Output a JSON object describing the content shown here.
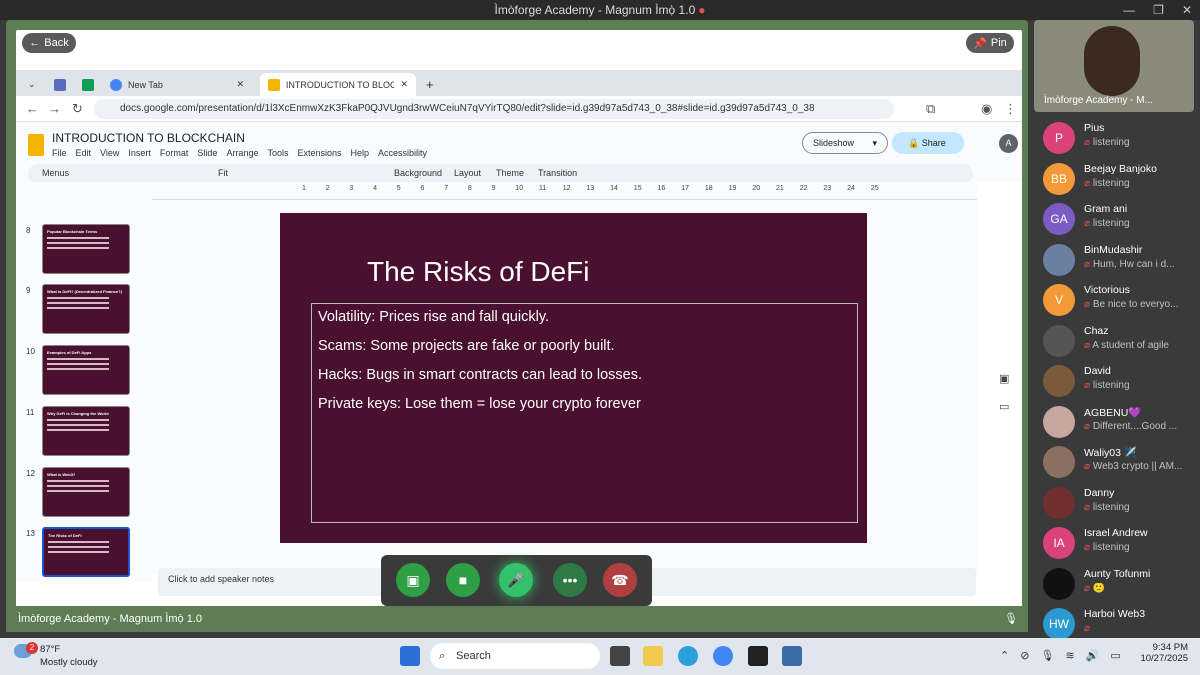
{
  "window": {
    "title": "Ìmòforge Academy - Magnum Ìmọ̀ 1.0"
  },
  "share": {
    "back_label": "Back",
    "pin_label": "Pin",
    "bottom_label": "Ìmòforge Academy - Magnum Ìmọ̀ 1.0"
  },
  "browser": {
    "tabs": [
      {
        "label": "New Tab"
      },
      {
        "label": "INTRODUCTION TO BLOCKCHA"
      }
    ],
    "url": "docs.google.com/presentation/d/1l3XcEnmwXzK3FkaP0QJVUgnd3rwWCeiuN7qVYirTQ80/edit?slide=id.g39d97a5d743_0_38#slide=id.g39d97a5d743_0_38"
  },
  "doc": {
    "title": "INTRODUCTION TO BLOCKCHAIN",
    "menus": [
      "File",
      "Edit",
      "View",
      "Insert",
      "Format",
      "Slide",
      "Arrange",
      "Tools",
      "Extensions",
      "Help",
      "Accessibility"
    ],
    "slideshow_label": "Slideshow",
    "share_label": "Share",
    "avatar": "A",
    "toolbar": {
      "menus": "Menus",
      "zoom": "Fit",
      "background": "Background",
      "layout": "Layout",
      "theme": "Theme",
      "transition": "Transition"
    }
  },
  "thumbnails": [
    {
      "num": "8",
      "title": "Popular Blockchain Terms"
    },
    {
      "num": "9",
      "title": "What is DeFi? (Decentralized Finance?)"
    },
    {
      "num": "10",
      "title": "Examples of DeFi Apps"
    },
    {
      "num": "11",
      "title": "Why DeFi is Changing the World"
    },
    {
      "num": "12",
      "title": "What is Web3?"
    },
    {
      "num": "13",
      "title": "The Risks of DeFi"
    }
  ],
  "ruler": [
    "1",
    "2",
    "3",
    "4",
    "5",
    "6",
    "7",
    "8",
    "9",
    "10",
    "11",
    "12",
    "13",
    "14",
    "15",
    "16",
    "17",
    "18",
    "19",
    "20",
    "21",
    "22",
    "23",
    "24",
    "25"
  ],
  "slide": {
    "title": "The Risks of DeFi",
    "bullets": [
      "Volatility: Prices rise and fall quickly.",
      "Scams: Some projects are fake or poorly built.",
      "Hacks: Bugs in smart contracts can lead to losses.",
      "Private keys: Lose them = lose your crypto forever"
    ]
  },
  "notes_placeholder": "Click to add speaker notes",
  "self_label": "Ìmòforge Academy - M...",
  "participants": [
    {
      "initials": "P",
      "name": "Pius",
      "status": "listening",
      "color": "#d9437a"
    },
    {
      "initials": "BB",
      "name": "Beejay Banjoko",
      "status": "listening",
      "color": "#f29a38"
    },
    {
      "initials": "GA",
      "name": "Gram ani",
      "status": "listening",
      "color": "#7b5cc4"
    },
    {
      "initials": "",
      "name": "BinMudashir",
      "status": "Hum, Hw can i d...",
      "color": "#6b7fa0"
    },
    {
      "initials": "V",
      "name": "Victorious",
      "status": "Be nice to everyo...",
      "color": "#f29a38"
    },
    {
      "initials": "",
      "name": "Chaz",
      "status": "A student of agile",
      "color": "#555"
    },
    {
      "initials": "",
      "name": "David",
      "status": "listening",
      "color": "#7a5a3a"
    },
    {
      "initials": "",
      "name": "AGBENU💜",
      "status": "Different....Good ...",
      "color": "#c9a6a0"
    },
    {
      "initials": "",
      "name": "Waliy03 ✈️",
      "status": "Web3 crypto || AM...",
      "color": "#8a7060"
    },
    {
      "initials": "",
      "name": "Danny",
      "status": "listening",
      "color": "#703030"
    },
    {
      "initials": "IA",
      "name": "Israel Andrew",
      "status": "listening",
      "color": "#d9437a"
    },
    {
      "initials": "",
      "name": "Aunty Tofunmi",
      "status": "🙁",
      "color": "#111"
    },
    {
      "initials": "HW",
      "name": "Harboi Web3",
      "status": "",
      "color": "#2a9ad0"
    }
  ],
  "taskbar": {
    "weather_temp": "87°F",
    "weather_desc": "Mostly cloudy",
    "weather_badge": "2",
    "search_label": "Search",
    "time": "9:34 PM",
    "date": "10/27/2025"
  }
}
